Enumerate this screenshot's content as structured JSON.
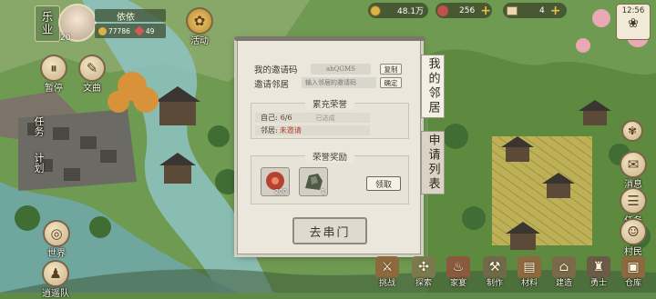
{
  "player": {
    "name": "依依",
    "level": "20",
    "coins": "77786",
    "gems": "49"
  },
  "left_panel": {
    "badge": "乐业",
    "hud": [
      "暂停",
      "文曲",
      "活动"
    ],
    "side": [
      "任务",
      "计划"
    ],
    "bottom": [
      "世界",
      "逍遥队"
    ]
  },
  "resources": {
    "copper": "48.1万",
    "meat": "256",
    "third": "4"
  },
  "clock": {
    "time": "12:56"
  },
  "dialog": {
    "my_invite_label": "我的邀请码",
    "my_invite_code": "ahQGMS",
    "copy_btn": "复制",
    "invite_label": "邀请邻居",
    "invite_placeholder": "输入邻居的邀请码",
    "confirm_btn": "确定",
    "honor_title": "累充荣誉",
    "self_label": "自己:",
    "self_value": "6/6",
    "self_status": "已达成",
    "neighbor_label": "邻居:",
    "neighbor_status": "未邀请",
    "reward_title": "荣誉奖励",
    "reward1_count": "200",
    "reward2_count": "1",
    "claim_btn": "领取",
    "go_btn": "去串门"
  },
  "tabs": {
    "my_neighbors": "我的邻居",
    "apply_list": "申请列表"
  },
  "right_side": [
    "消息",
    "任务",
    "村民"
  ],
  "bottom_nav": [
    "挑战",
    "探索",
    "家宴",
    "制作",
    "材料",
    "建造",
    "勇士",
    "仓库"
  ],
  "colors": {
    "accent": "#b5432f",
    "gold": "#e6c04a",
    "panel": "#ece7dc"
  }
}
